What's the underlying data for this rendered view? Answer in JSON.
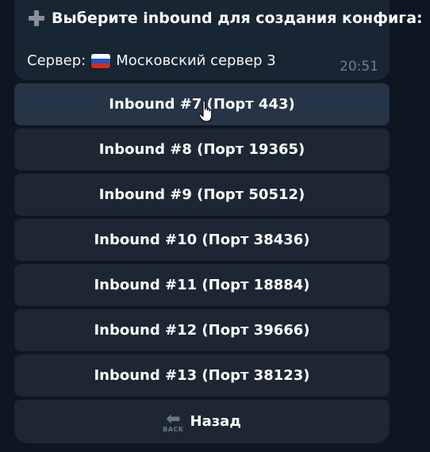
{
  "message": {
    "title": "Выберите inbound для создания конфига:",
    "server_prefix": "Сервер:",
    "server_flag": "russia-flag-icon",
    "server_name": "Московский сервер 3",
    "time": "20:51"
  },
  "keyboard": {
    "buttons": [
      {
        "label": "Inbound #7 (Порт 443)"
      },
      {
        "label": "Inbound #8 (Порт 19365)"
      },
      {
        "label": "Inbound #9 (Порт 50512)"
      },
      {
        "label": "Inbound #10 (Порт 38436)"
      },
      {
        "label": "Inbound #11 (Порт 18884)"
      },
      {
        "label": "Inbound #12 (Порт 39666)"
      },
      {
        "label": "Inbound #13 (Порт 38123)"
      }
    ],
    "back_label": "Назад",
    "back_icon_text": "BACK"
  },
  "colors": {
    "background": "#0e1621",
    "message_bubble": "#182533",
    "button": "#1d2733",
    "button_hover": "#253446"
  }
}
